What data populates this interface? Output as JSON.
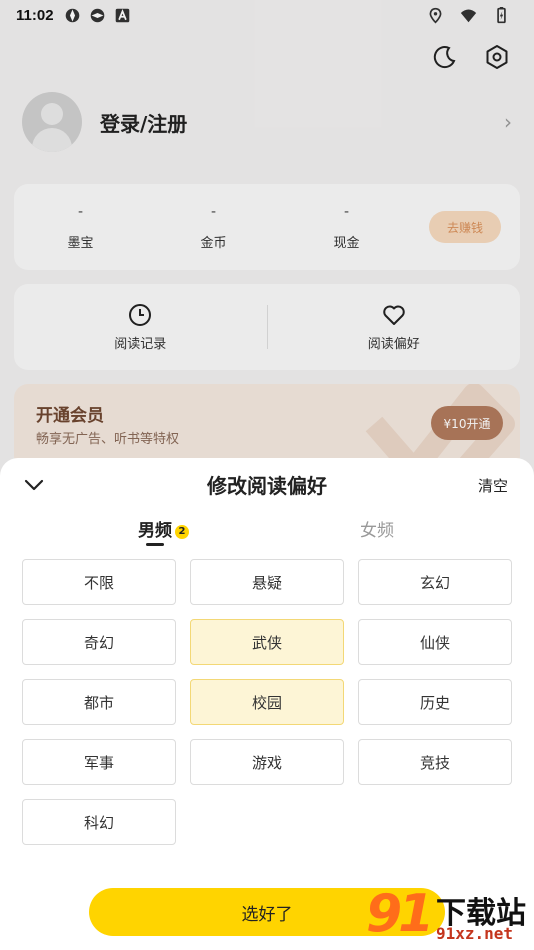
{
  "status_bar": {
    "time": "11:02"
  },
  "profile": {
    "login_label": "登录/注册"
  },
  "wallet": {
    "stats": [
      {
        "value": "-",
        "label": "墨宝"
      },
      {
        "value": "-",
        "label": "金币"
      },
      {
        "value": "-",
        "label": "现金"
      }
    ],
    "earn_button": "去赚钱"
  },
  "shortcuts": {
    "history": "阅读记录",
    "preference": "阅读偏好"
  },
  "vip": {
    "title": "开通会员",
    "subtitle": "畅享无广告、听书等特权",
    "button": "¥10开通"
  },
  "sheet": {
    "title": "修改阅读偏好",
    "clear": "清空",
    "tabs": {
      "male": {
        "label": "男频",
        "badge": "2"
      },
      "female": {
        "label": "女频"
      }
    },
    "genres": [
      {
        "label": "不限",
        "selected": false
      },
      {
        "label": "悬疑",
        "selected": false
      },
      {
        "label": "玄幻",
        "selected": false
      },
      {
        "label": "奇幻",
        "selected": false
      },
      {
        "label": "武侠",
        "selected": true
      },
      {
        "label": "仙侠",
        "selected": false
      },
      {
        "label": "都市",
        "selected": false
      },
      {
        "label": "校园",
        "selected": true
      },
      {
        "label": "历史",
        "selected": false
      },
      {
        "label": "军事",
        "selected": false
      },
      {
        "label": "游戏",
        "selected": false
      },
      {
        "label": "竞技",
        "selected": false
      },
      {
        "label": "科幻",
        "selected": false
      }
    ],
    "confirm": "选好了"
  },
  "watermark": {
    "number": "91",
    "brand": "下载站",
    "url": "91xz.net"
  },
  "colors": {
    "accent": "#ffd400",
    "selected_bg": "#fdf5d6",
    "vip_button": "#b07a5c"
  }
}
